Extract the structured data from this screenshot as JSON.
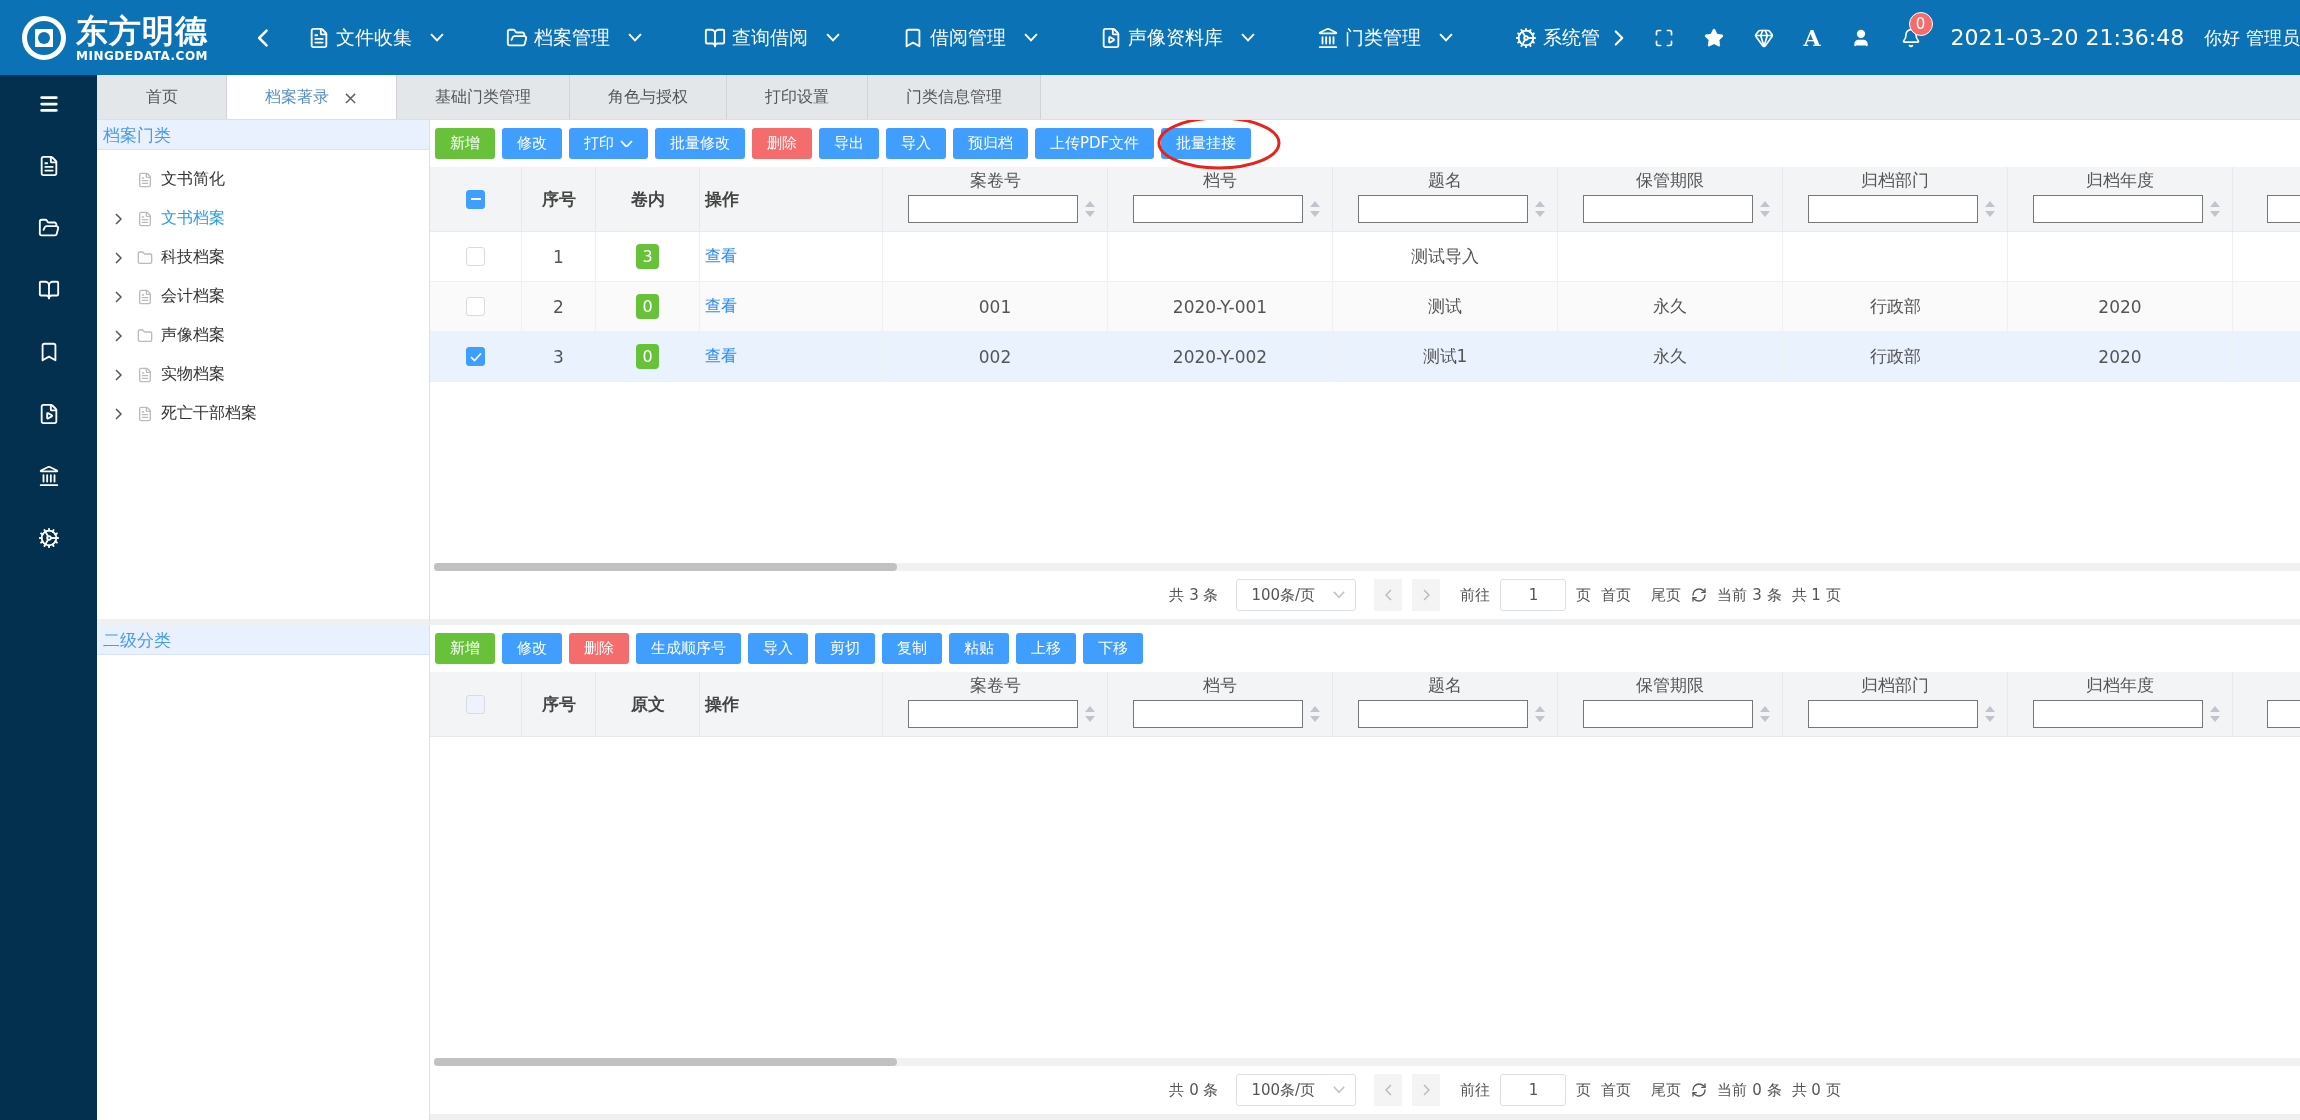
{
  "header": {
    "logo_title": "东方明德",
    "logo_subtitle": "MINGDEDATA.COM",
    "nav": [
      {
        "label": "文件收集",
        "dropdown": true
      },
      {
        "label": "档案管理",
        "dropdown": true
      },
      {
        "label": "查询借阅",
        "dropdown": true
      },
      {
        "label": "借阅管理",
        "dropdown": true
      },
      {
        "label": "声像资料库",
        "dropdown": true
      },
      {
        "label": "门类管理",
        "dropdown": true
      },
      {
        "label": "系统管",
        "dropdown": false
      }
    ],
    "font_button": "A",
    "notification_count": "0",
    "datetime": "2021-03-20 21:36:48",
    "greeting": "你好 管理员"
  },
  "tabs": [
    {
      "label": "首页",
      "selected": false
    },
    {
      "label": "档案著录",
      "selected": true,
      "close": "×"
    },
    {
      "label": "基础门类管理",
      "selected": false
    },
    {
      "label": "角色与授权",
      "selected": false
    },
    {
      "label": "打印设置",
      "selected": false
    },
    {
      "label": "门类信息管理",
      "selected": false
    }
  ],
  "category_panel": {
    "title": "档案门类",
    "items": [
      {
        "label": "文书简化",
        "kind": "document",
        "expandable": false,
        "selected": false
      },
      {
        "label": "文书档案",
        "kind": "document",
        "expandable": true,
        "selected": true
      },
      {
        "label": "科技档案",
        "kind": "folder",
        "expandable": true,
        "selected": false
      },
      {
        "label": "会计档案",
        "kind": "document",
        "expandable": true,
        "selected": false
      },
      {
        "label": "声像档案",
        "kind": "folder",
        "expandable": true,
        "selected": false
      },
      {
        "label": "实物档案",
        "kind": "document",
        "expandable": true,
        "selected": false
      },
      {
        "label": "死亡干部档案",
        "kind": "document",
        "expandable": true,
        "selected": false
      }
    ]
  },
  "subcategory_panel": {
    "title": "二级分类"
  },
  "upper_table": {
    "toolbar": [
      {
        "label": "新增",
        "kind": "success"
      },
      {
        "label": "修改",
        "kind": "primary"
      },
      {
        "label": "打印",
        "kind": "primary",
        "dropdown": true
      },
      {
        "label": "批量修改",
        "kind": "primary"
      },
      {
        "label": "删除",
        "kind": "danger"
      },
      {
        "label": "导出",
        "kind": "primary"
      },
      {
        "label": "导入",
        "kind": "primary"
      },
      {
        "label": "预归档",
        "kind": "primary"
      },
      {
        "label": "上传PDF文件",
        "kind": "primary"
      },
      {
        "label": "批量挂接",
        "kind": "primary",
        "circled": true
      }
    ],
    "select_all": {
      "indeterminate": true,
      "disabled": false
    },
    "fixed_columns": [
      "序号",
      "卷内",
      "操作"
    ],
    "columns": [
      {
        "label": "案卷号"
      },
      {
        "label": "档号"
      },
      {
        "label": "题名"
      },
      {
        "label": "保管期限"
      },
      {
        "label": "归档部门"
      },
      {
        "label": "归档年度"
      },
      {}
    ],
    "rows": [
      {
        "checked": false,
        "index": "1",
        "inner_count": "3",
        "action": "查看",
        "cells": [
          null,
          null,
          "测试导入",
          null,
          null,
          null
        ]
      },
      {
        "checked": false,
        "index": "2",
        "inner_count": "0",
        "action": "查看",
        "cells": [
          "001",
          "2020-Y-001",
          "测试",
          "永久",
          "行政部",
          "2020"
        ]
      },
      {
        "checked": true,
        "index": "3",
        "inner_count": "0",
        "action": "查看",
        "cells": [
          "002",
          "2020-Y-002",
          "测试1",
          "永久",
          "行政部",
          "2020"
        ]
      }
    ],
    "pagination": {
      "total": "共 3 条",
      "page_size": "100条/页",
      "goto": "前往",
      "page": "1",
      "page_unit": "页",
      "first": "首页",
      "last": "尾页",
      "current": "当前 3 条",
      "pages": "共 1 页"
    }
  },
  "lower_table": {
    "toolbar": [
      {
        "label": "新增",
        "kind": "success"
      },
      {
        "label": "修改",
        "kind": "primary"
      },
      {
        "label": "删除",
        "kind": "danger"
      },
      {
        "label": "生成顺序号",
        "kind": "primary"
      },
      {
        "label": "导入",
        "kind": "primary"
      },
      {
        "label": "剪切",
        "kind": "primary"
      },
      {
        "label": "复制",
        "kind": "primary"
      },
      {
        "label": "粘贴",
        "kind": "primary"
      },
      {
        "label": "上移",
        "kind": "primary"
      },
      {
        "label": "下移",
        "kind": "primary"
      }
    ],
    "select_all": {
      "indeterminate": false,
      "disabled": true
    },
    "fixed_columns": [
      "序号",
      "原文",
      "操作"
    ],
    "columns": [
      {
        "label": "案卷号"
      },
      {
        "label": "档号"
      },
      {
        "label": "题名"
      },
      {
        "label": "保管期限"
      },
      {
        "label": "归档部门"
      },
      {
        "label": "归档年度"
      },
      {}
    ],
    "pagination": {
      "total": "共 0 条",
      "page_size": "100条/页",
      "goto": "前往",
      "page": "1",
      "page_unit": "页",
      "first": "首页",
      "last": "尾页",
      "current": "当前 0 条",
      "pages": "共 0 页"
    }
  }
}
